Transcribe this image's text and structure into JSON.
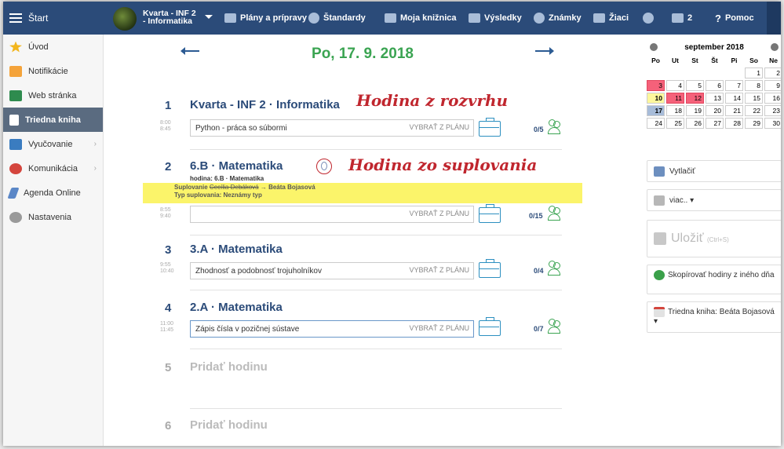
{
  "topbar": {
    "start_label": "Štart",
    "course_line1": "Kvarta - INF 2",
    "course_line2": "- Informatika",
    "nav": [
      {
        "label": "Plány a prípravy",
        "icon": "plans-icon"
      },
      {
        "label": "Štandardy",
        "icon": "shield-icon"
      },
      {
        "label": "Moja knižnica",
        "icon": "library-icon"
      },
      {
        "label": "Výsledky",
        "icon": "bar-chart-icon"
      },
      {
        "label": "Známky",
        "icon": "grades-icon"
      },
      {
        "label": "Žiaci",
        "icon": "students-icon"
      }
    ],
    "messages_count": "2",
    "help_label": "Pomoc"
  },
  "sidebar": {
    "items": [
      {
        "label": "Úvod",
        "icon": "star-icon"
      },
      {
        "label": "Notifikácie",
        "icon": "envelope-icon"
      },
      {
        "label": "Web stránka",
        "icon": "home-icon"
      },
      {
        "label": "Triedna kniha",
        "icon": "book-icon"
      },
      {
        "label": "Vyučovanie",
        "icon": "hat-icon"
      },
      {
        "label": "Komunikácia",
        "icon": "chat-icon"
      },
      {
        "label": "Agenda Online",
        "icon": "pen-icon"
      },
      {
        "label": "Nastavenia",
        "icon": "gear-icon"
      }
    ]
  },
  "main": {
    "date_title": "Po, 17. 9. 2018",
    "pick_label": "VYBRAŤ Z PLÁNU",
    "lessons": [
      {
        "num": "1",
        "title": "Kvarta - INF 2 · Informatika",
        "time_start": "8:00",
        "time_end": "8:45",
        "topic": "Python - práca so súbormi",
        "count": "0/5"
      },
      {
        "num": "2",
        "title": "6.B · Matematika",
        "time_start": "8:55",
        "time_end": "9:40",
        "topic": "",
        "count": "0/15",
        "sub_label": "hodina: 6.B · Matematika",
        "subst_line1_prefix": "Suplovanie",
        "subst_line1_old": "Cecília Debáková",
        "subst_line1_new": "→ Beáta Bojasová",
        "subst_line2": "Typ suplovania: Neznámy typ"
      },
      {
        "num": "3",
        "title": "3.A · Matematika",
        "time_start": "9:55",
        "time_end": "10:40",
        "topic": "Zhodnosť a podobnosť trojuholníkov",
        "count": "0/4"
      },
      {
        "num": "4",
        "title": "2.A · Matematika",
        "time_start": "11:00",
        "time_end": "11:45",
        "topic": "Zápis čísla v pozičnej sústave",
        "count": "0/7"
      },
      {
        "num": "5",
        "title": "Pridať hodinu"
      },
      {
        "num": "6",
        "title": "Pridať hodinu"
      }
    ],
    "annotation_schedule": "Hodina z rozvrhu",
    "annotation_subst": "Hodina zo suplovania"
  },
  "calendar": {
    "month": "september 2018",
    "dow": [
      "Po",
      "Ut",
      "St",
      "Št",
      "Pi",
      "So",
      "Ne"
    ],
    "weeks": [
      [
        "",
        "",
        "",
        "",
        "",
        "1",
        "2"
      ],
      [
        "3",
        "4",
        "5",
        "6",
        "7",
        "8",
        "9"
      ],
      [
        "10",
        "11",
        "12",
        "13",
        "14",
        "15",
        "16"
      ],
      [
        "17",
        "18",
        "19",
        "20",
        "21",
        "22",
        "23"
      ],
      [
        "24",
        "25",
        "26",
        "27",
        "28",
        "29",
        "30"
      ]
    ],
    "red_days": [
      "3",
      "11",
      "12"
    ],
    "yellow_days": [
      "10"
    ],
    "today": "17"
  },
  "right": {
    "print_label": "Vytlačiť",
    "more_label": "viac.. ▾",
    "save_label": "Uložiť",
    "save_shortcut": "(Ctrl+S)",
    "copy_label": "Skopírovať hodiny z iného dňa",
    "book_label": "Triedna kniha: Beáta Bojasová ▾"
  },
  "colors": {
    "topbar": "#2b4b79",
    "accent_green": "#3ba452",
    "annotation_red": "#c0262e",
    "subst_yellow": "#fbf46a"
  }
}
